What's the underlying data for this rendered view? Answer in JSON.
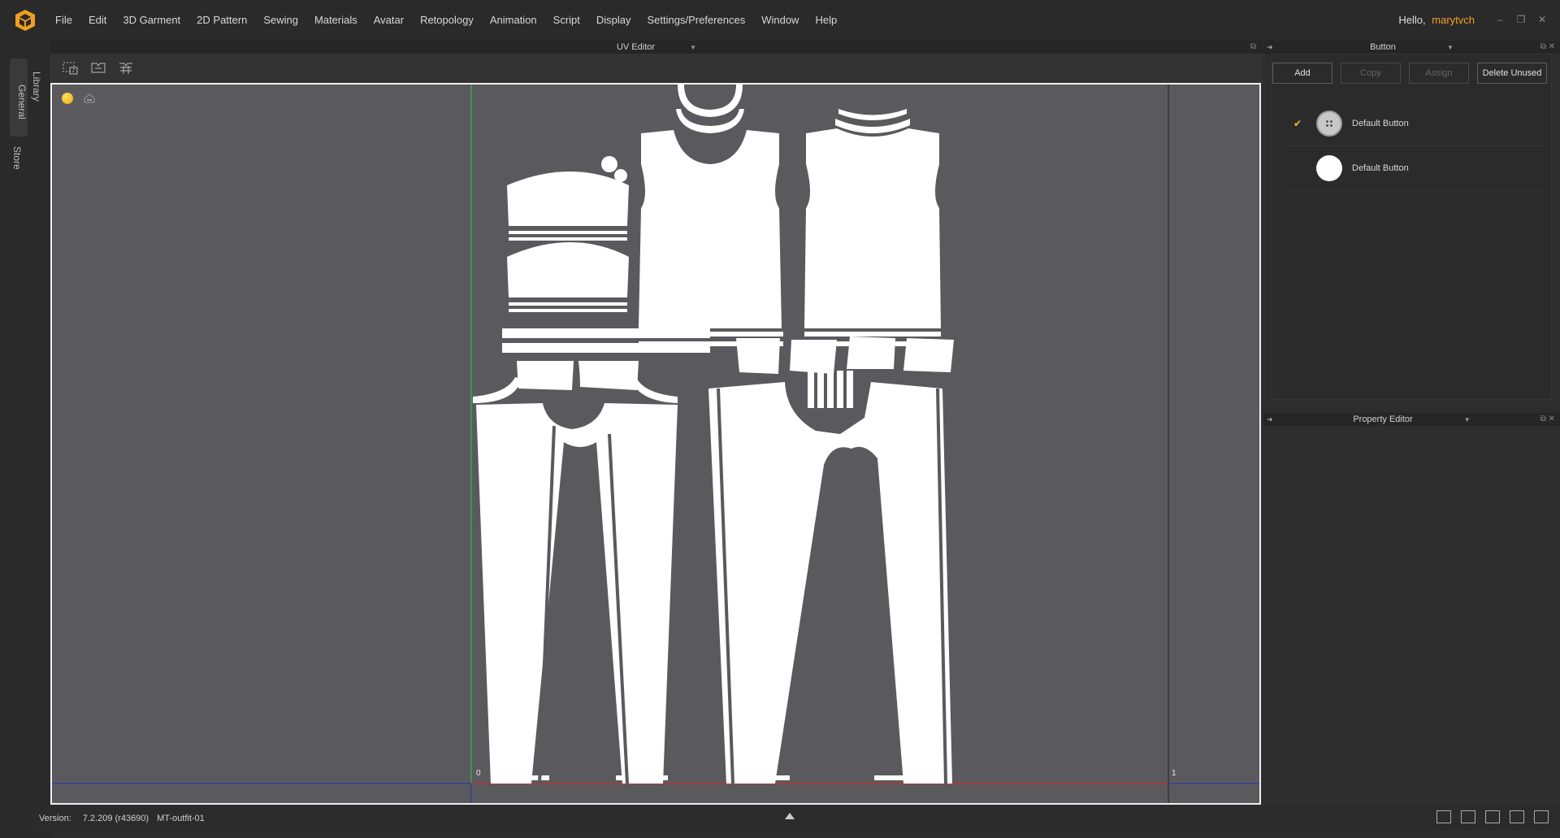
{
  "menu": {
    "items": [
      "File",
      "Edit",
      "3D Garment",
      "2D Pattern",
      "Sewing",
      "Materials",
      "Avatar",
      "Retopology",
      "Animation",
      "Script",
      "Display",
      "Settings/Preferences",
      "Window",
      "Help"
    ]
  },
  "greeting": {
    "prefix": "Hello,",
    "user": "marytvch"
  },
  "left_tabs": {
    "general": "General",
    "library": "Library",
    "store": "Store"
  },
  "uv_editor": {
    "title": "UV Editor",
    "axis_labels": {
      "origin": "0",
      "one": "1"
    },
    "toolbar_icons": [
      "uv-select-icon",
      "uv-transform-icon",
      "uv-grid-icon"
    ],
    "canvas_icons": [
      "sun-icon",
      "tag-icon"
    ]
  },
  "button_panel": {
    "title": "Button",
    "actions": {
      "add": "Add",
      "copy": "Copy",
      "assign": "Assign",
      "delete_unused": "Delete Unused"
    },
    "items": [
      {
        "label": "Default Button",
        "selected": true,
        "style": "gray"
      },
      {
        "label": "Default Button",
        "selected": false,
        "style": "white"
      }
    ]
  },
  "property_editor": {
    "title": "Property Editor"
  },
  "status": {
    "version_label": "Version:",
    "version": "7.2.209 (r43690)",
    "project": "MT-outfit-01"
  },
  "colors": {
    "accent": "#f0a020",
    "canvas_bg": "#5a5a5e",
    "pattern": "#ffffff",
    "v_axis": "#2ecc40",
    "u_axis": "#e02020",
    "baseline": "#2030c0"
  }
}
